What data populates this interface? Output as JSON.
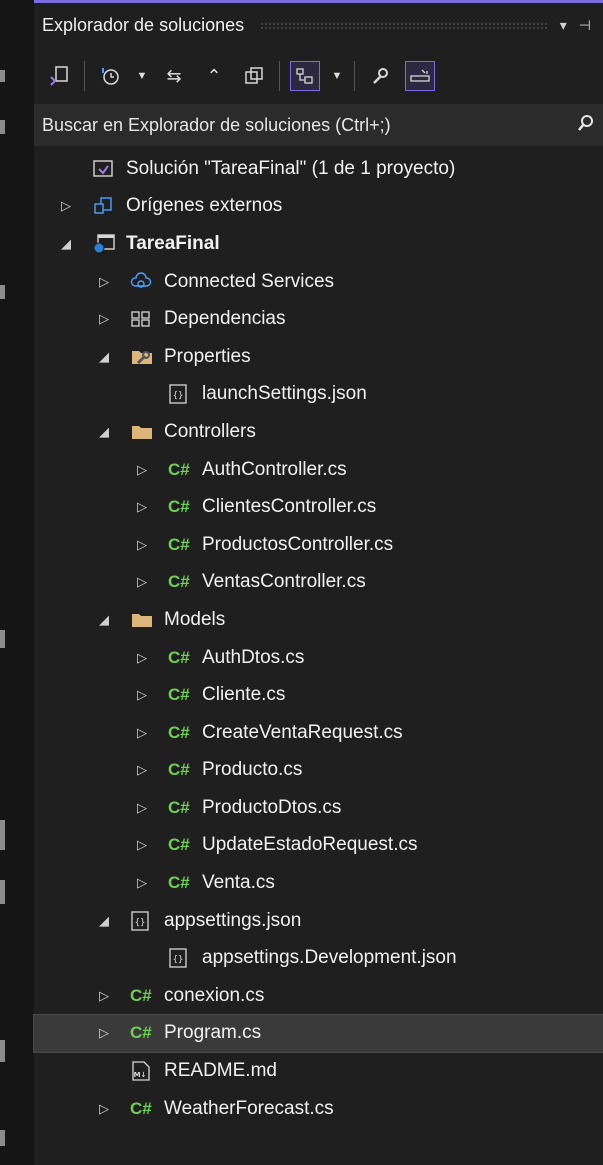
{
  "panel": {
    "title": "Explorador de soluciones",
    "pin_glyph": "▾",
    "pin2_glyph": "⊣",
    "close_glyph": "✕"
  },
  "toolbar": {
    "icons": [
      "vs-switch-views-icon",
      "history-icon",
      "sync-icon",
      "collapse-all-icon",
      "copy-icon",
      "show-all-files-icon",
      "properties-icon",
      "preview-icon"
    ]
  },
  "search": {
    "placeholder": "Buscar en Explorador de soluciones (Ctrl+;)"
  },
  "tree": [
    {
      "label": "Solución \"TareaFinal\"  (1 de 1 proyecto)",
      "icon": "solution-icon",
      "arrow": "",
      "indent": 0
    },
    {
      "label": "Orígenes externos",
      "icon": "external-sources-icon",
      "arrow": "▷",
      "indent": 0
    },
    {
      "label": "TareaFinal",
      "icon": "web-project-icon",
      "arrow": "◢",
      "indent": 0,
      "bold": true
    },
    {
      "label": "Connected Services",
      "icon": "connected-services-icon",
      "arrow": "▷",
      "indent": 1
    },
    {
      "label": "Dependencias",
      "icon": "dependencies-icon",
      "arrow": "▷",
      "indent": 1
    },
    {
      "label": "Properties",
      "icon": "properties-folder-icon",
      "arrow": "◢",
      "indent": 1
    },
    {
      "label": "launchSettings.json",
      "icon": "json-file-icon",
      "arrow": "",
      "indent": 2
    },
    {
      "label": "Controllers",
      "icon": "folder-icon",
      "arrow": "◢",
      "indent": 1
    },
    {
      "label": "AuthController.cs",
      "icon": "csharp-file-icon",
      "arrow": "▷",
      "indent": 2
    },
    {
      "label": "ClientesController.cs",
      "icon": "csharp-file-icon",
      "arrow": "▷",
      "indent": 2
    },
    {
      "label": "ProductosController.cs",
      "icon": "csharp-file-icon",
      "arrow": "▷",
      "indent": 2
    },
    {
      "label": "VentasController.cs",
      "icon": "csharp-file-icon",
      "arrow": "▷",
      "indent": 2
    },
    {
      "label": "Models",
      "icon": "folder-icon",
      "arrow": "◢",
      "indent": 1
    },
    {
      "label": "AuthDtos.cs",
      "icon": "csharp-file-icon",
      "arrow": "▷",
      "indent": 2
    },
    {
      "label": "Cliente.cs",
      "icon": "csharp-file-icon",
      "arrow": "▷",
      "indent": 2
    },
    {
      "label": "CreateVentaRequest.cs",
      "icon": "csharp-file-icon",
      "arrow": "▷",
      "indent": 2
    },
    {
      "label": "Producto.cs",
      "icon": "csharp-file-icon",
      "arrow": "▷",
      "indent": 2
    },
    {
      "label": "ProductoDtos.cs",
      "icon": "csharp-file-icon",
      "arrow": "▷",
      "indent": 2
    },
    {
      "label": "UpdateEstadoRequest.cs",
      "icon": "csharp-file-icon",
      "arrow": "▷",
      "indent": 2
    },
    {
      "label": "Venta.cs",
      "icon": "csharp-file-icon",
      "arrow": "▷",
      "indent": 2
    },
    {
      "label": "appsettings.json",
      "icon": "json-file-icon",
      "arrow": "◢",
      "indent": 1
    },
    {
      "label": "appsettings.Development.json",
      "icon": "json-file-icon",
      "arrow": "",
      "indent": 2
    },
    {
      "label": "conexion.cs",
      "icon": "csharp-file-icon",
      "arrow": "▷",
      "indent": 1
    },
    {
      "label": "Program.cs",
      "icon": "csharp-file-icon",
      "arrow": "▷",
      "indent": 1,
      "selected": true
    },
    {
      "label": "README.md",
      "icon": "markdown-file-icon",
      "arrow": "",
      "indent": 1
    },
    {
      "label": "WeatherForecast.cs",
      "icon": "csharp-file-icon",
      "arrow": "▷",
      "indent": 1
    }
  ],
  "colors": {
    "accent": "#7c6ce0",
    "csharp": "#6fcf56",
    "background": "#1f1f1f",
    "selected_row": "#3a3a3a"
  }
}
